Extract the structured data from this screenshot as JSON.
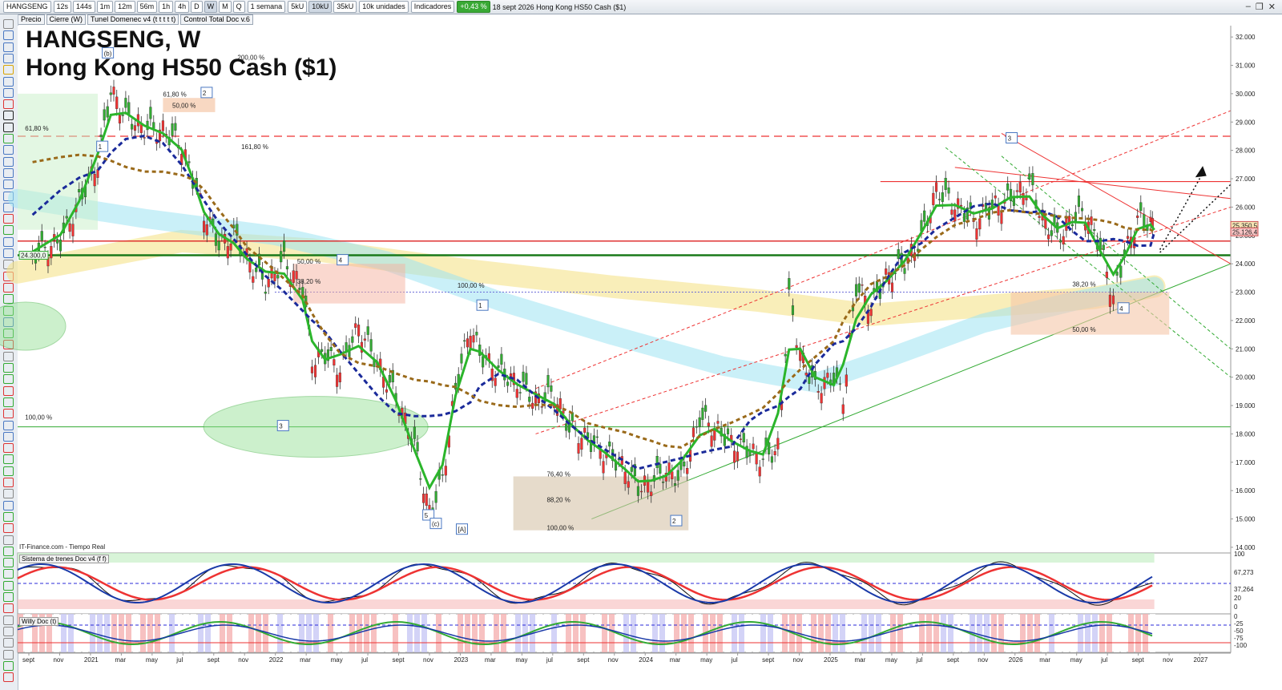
{
  "toolbar": {
    "symbol": "HANGSENG",
    "periods": [
      "12s",
      "144s",
      "1m",
      "12m",
      "56m",
      "1h",
      "4h",
      "D",
      "W",
      "M",
      "Q"
    ],
    "active_period": "W",
    "range": "1 semana",
    "units": [
      "5kU",
      "10kU",
      "35kU"
    ],
    "units_selected": "10k unidades",
    "indicators": "Indicadores",
    "change": "+0,43 %",
    "date_info": "18 sept 2026  Hong Kong HS50 Cash ($1)",
    "change_color": "#39a935"
  },
  "toolbar2": [
    "Precio",
    "Cierre (W)",
    "Tunel Domenec v4 (t t t t t)",
    "Control Total Doc v.6"
  ],
  "chart_title": {
    "line1": "HANGSENG, W",
    "line2": "Hong Kong HS50 Cash ($1)"
  },
  "source_label": "IT-Finance.com - Tiempo Real",
  "oscillator1_title": "Sistema de trenes Doc v4 (f f)",
  "oscillator2_title": "Willy Doc (t)",
  "chart_data": {
    "type": "line",
    "title": "HANGSENG, W",
    "subtitle": "Hong Kong HS50 Cash ($1)",
    "y_ticks": [
      "32.000",
      "31.000",
      "30.000",
      "29.000",
      "28.000",
      "27.000",
      "26.000",
      "25.000",
      "24.000",
      "23.000",
      "22.000",
      "21.000",
      "20.000",
      "19.000",
      "18.000",
      "17.000",
      "16.000",
      "15.000",
      "14.000"
    ],
    "y_range": [
      13800,
      32400
    ],
    "x_ticks": [
      "sept",
      "nov",
      "2021",
      "mar",
      "may",
      "jul",
      "sept",
      "nov",
      "2022",
      "mar",
      "may",
      "jul",
      "sept",
      "nov",
      "2023",
      "mar",
      "may",
      "jul",
      "sept",
      "nov",
      "2024",
      "mar",
      "may",
      "jul",
      "sept",
      "nov",
      "2025",
      "mar",
      "may",
      "jul",
      "sept",
      "nov",
      "2026",
      "mar",
      "may",
      "jul",
      "sept",
      "nov",
      "2027"
    ],
    "x_range": [
      "2020-08",
      "2027-02"
    ],
    "price_tags": [
      "25.350,5",
      "25.126,4"
    ],
    "left_tag": "24.300,0",
    "series": [
      {
        "values": [
          [
            2020.7,
            24300
          ],
          [
            2020.85,
            24800
          ],
          [
            2020.95,
            26200
          ],
          [
            2021.05,
            27600
          ],
          [
            2021.12,
            30100
          ],
          [
            2021.2,
            29200
          ],
          [
            2021.3,
            28800
          ],
          [
            2021.4,
            28700
          ],
          [
            2021.5,
            28200
          ],
          [
            2021.56,
            27000
          ],
          [
            2021.62,
            25800
          ],
          [
            2021.7,
            24700
          ],
          [
            2021.78,
            25000
          ],
          [
            2021.85,
            24200
          ],
          [
            2021.95,
            23300
          ],
          [
            2022.05,
            24100
          ],
          [
            2022.15,
            23100
          ],
          [
            2022.2,
            20600
          ],
          [
            2022.27,
            20800
          ],
          [
            2022.35,
            20300
          ],
          [
            2022.45,
            21800
          ],
          [
            2022.55,
            20500
          ],
          [
            2022.65,
            19300
          ],
          [
            2022.75,
            17600
          ],
          [
            2022.83,
            15200
          ],
          [
            2022.9,
            16400
          ],
          [
            2022.97,
            19600
          ],
          [
            2023.05,
            21800
          ],
          [
            2023.1,
            20800
          ],
          [
            2023.2,
            20200
          ],
          [
            2023.3,
            19800
          ],
          [
            2023.4,
            19200
          ],
          [
            2023.5,
            19400
          ],
          [
            2023.58,
            18200
          ],
          [
            2023.68,
            17800
          ],
          [
            2023.78,
            17300
          ],
          [
            2023.88,
            16800
          ],
          [
            2023.95,
            16100
          ],
          [
            2024.02,
            16300
          ],
          [
            2024.1,
            16700
          ],
          [
            2024.18,
            16400
          ],
          [
            2024.28,
            18600
          ],
          [
            2024.36,
            18200
          ],
          [
            2024.45,
            17700
          ],
          [
            2024.55,
            17400
          ],
          [
            2024.62,
            17100
          ],
          [
            2024.7,
            17500
          ],
          [
            2024.76,
            22800
          ],
          [
            2024.82,
            20800
          ],
          [
            2024.9,
            19600
          ],
          [
            2025.0,
            20000
          ],
          [
            2025.05,
            19300
          ],
          [
            2025.12,
            23200
          ],
          [
            2025.2,
            22500
          ],
          [
            2025.28,
            23500
          ],
          [
            2025.38,
            24000
          ],
          [
            2025.47,
            24900
          ],
          [
            2025.55,
            26600
          ],
          [
            2025.65,
            26100
          ],
          [
            2025.75,
            25500
          ],
          [
            2025.85,
            26000
          ],
          [
            2025.95,
            26300
          ],
          [
            2026.05,
            26800
          ],
          [
            2026.12,
            25600
          ],
          [
            2026.2,
            24900
          ],
          [
            2026.28,
            25600
          ],
          [
            2026.35,
            25800
          ],
          [
            2026.43,
            24600
          ],
          [
            2026.5,
            22800
          ],
          [
            2026.56,
            24300
          ],
          [
            2026.63,
            25600
          ],
          [
            2026.7,
            25400
          ],
          [
            2026.72,
            25126
          ]
        ]
      }
    ],
    "fib_labels": [
      "200,00 %",
      "161,80 %",
      "61,80 %",
      "50,00 %",
      "61,80 %",
      "50,00 %",
      "38,20 %",
      "100,00 %",
      "100,00 %",
      "76,40 %",
      "88,20 %",
      "100,00 %",
      "38,20 %",
      "50,00 %"
    ],
    "wave_labels": [
      "(b)",
      "2",
      "1",
      "4",
      "3",
      "5",
      "(c)",
      "[A]",
      "1",
      "2",
      "3",
      "4"
    ]
  }
}
